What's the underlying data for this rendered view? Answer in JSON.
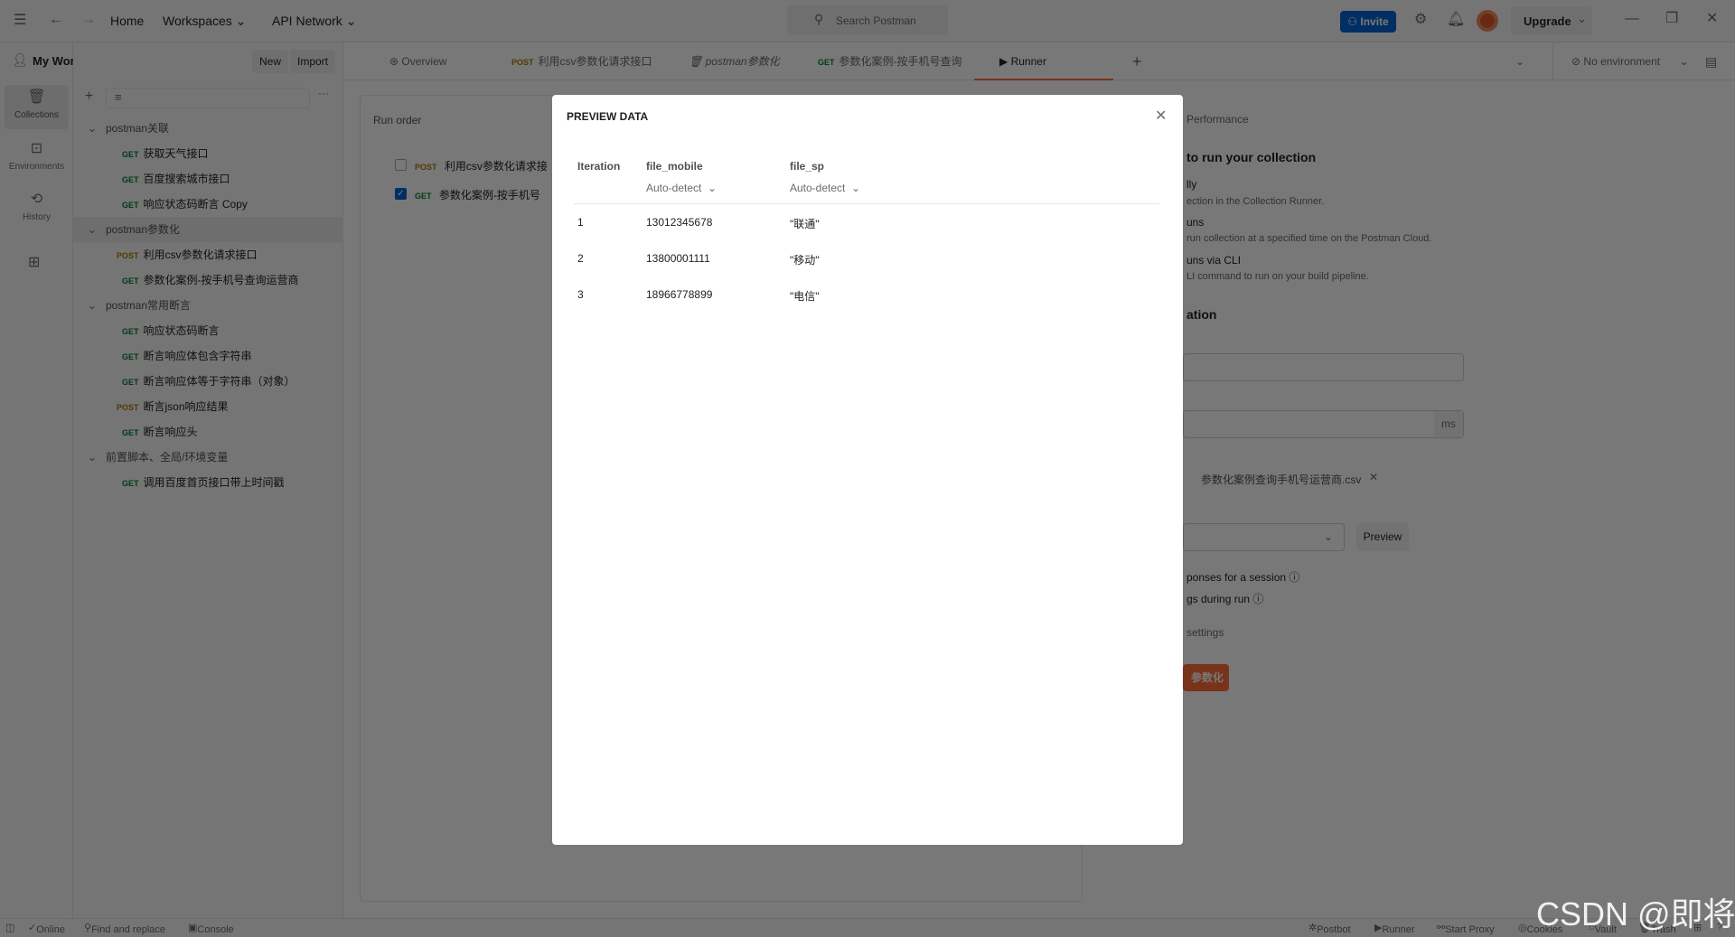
{
  "topbar": {
    "home": "Home",
    "workspaces": "Workspaces",
    "api_network": "API Network",
    "search_placeholder": "Search Postman",
    "invite": "Invite",
    "upgrade": "Upgrade"
  },
  "sidebar": {
    "workspace": "My Workspace",
    "new": "New",
    "import": "Import",
    "rail": [
      {
        "label": "Collections",
        "icon": "collections-icon"
      },
      {
        "label": "Environments",
        "icon": "environments-icon"
      },
      {
        "label": "History",
        "icon": "history-icon"
      }
    ],
    "tree": [
      {
        "type": "folder",
        "label": "postman关联"
      },
      {
        "type": "req",
        "method": "GET",
        "label": "获取天气接口"
      },
      {
        "type": "req",
        "method": "GET",
        "label": "百度搜索城市接口"
      },
      {
        "type": "req",
        "method": "GET",
        "label": "响应状态码断言 Copy"
      },
      {
        "type": "folder",
        "label": "postman参数化",
        "selected": true
      },
      {
        "type": "req",
        "method": "POST",
        "label": "利用csv参数化请求接口"
      },
      {
        "type": "req",
        "method": "GET",
        "label": "参数化案例-按手机号查询运营商"
      },
      {
        "type": "folder",
        "label": "postman常用断言"
      },
      {
        "type": "req",
        "method": "GET",
        "label": "响应状态码断言"
      },
      {
        "type": "req",
        "method": "GET",
        "label": "断言响应体包含字符串"
      },
      {
        "type": "req",
        "method": "GET",
        "label": "断言响应体等于字符串（对象）"
      },
      {
        "type": "req",
        "method": "POST",
        "label": "断言json响应结果"
      },
      {
        "type": "req",
        "method": "GET",
        "label": "断言响应头"
      },
      {
        "type": "folder",
        "label": "前置脚本、全局/环境变量"
      },
      {
        "type": "req",
        "method": "GET",
        "label": "调用百度首页接口带上时间戳"
      }
    ]
  },
  "tabs": [
    {
      "label": "Overview"
    },
    {
      "method": "POST",
      "label": "利用csv参数化请求接口"
    },
    {
      "label": "postman参数化"
    },
    {
      "method": "GET",
      "label": "参数化案例-按手机号查询"
    },
    {
      "label": "Runner",
      "active": true
    }
  ],
  "environment": "No environment",
  "runner": {
    "run_order": "Run order",
    "items": [
      {
        "method": "POST",
        "label": "利用csv参数化请求接",
        "checked": false
      },
      {
        "method": "GET",
        "label": "参数化案例-按手机号",
        "checked": true
      }
    ]
  },
  "right_panel": {
    "performance": "Performance",
    "heading": "to run your collection",
    "l1": "lly",
    "l1d": "ection in the Collection Runner.",
    "l2": "uns",
    "l2d": "run collection at a specified time on the Postman Cloud.",
    "l3": "uns via CLI",
    "l3d": "LI command to run on your build pipeline.",
    "heading2": "ation",
    "ms": "ms",
    "file": "参数化案例查询手机号运营商.csv",
    "preview": "Preview",
    "opt1": "ponses for a session",
    "opt2": "gs during run",
    "settings": "settings",
    "run_btn": "参数化"
  },
  "modal": {
    "title": "PREVIEW DATA",
    "headers": [
      "Iteration",
      "file_mobile",
      "file_sp"
    ],
    "type_select": "Auto-detect",
    "rows": [
      [
        "1",
        "13012345678",
        "\"联通\""
      ],
      [
        "2",
        "13800001111",
        "\"移动\""
      ],
      [
        "3",
        "18966778899",
        "\"电信\""
      ]
    ]
  },
  "status": {
    "online": "Online",
    "find": "Find and replace",
    "console": "Console",
    "postbot": "Postbot",
    "runner": "Runner",
    "proxy": "Start Proxy",
    "cookies": "Cookies",
    "vault": "Vault",
    "trash": "Trash"
  },
  "watermark": "CSDN @即将",
  "colors": {
    "accent": "#ff6c37",
    "invite": "#0265d2",
    "get": "#007f31",
    "post": "#ad7a03"
  }
}
